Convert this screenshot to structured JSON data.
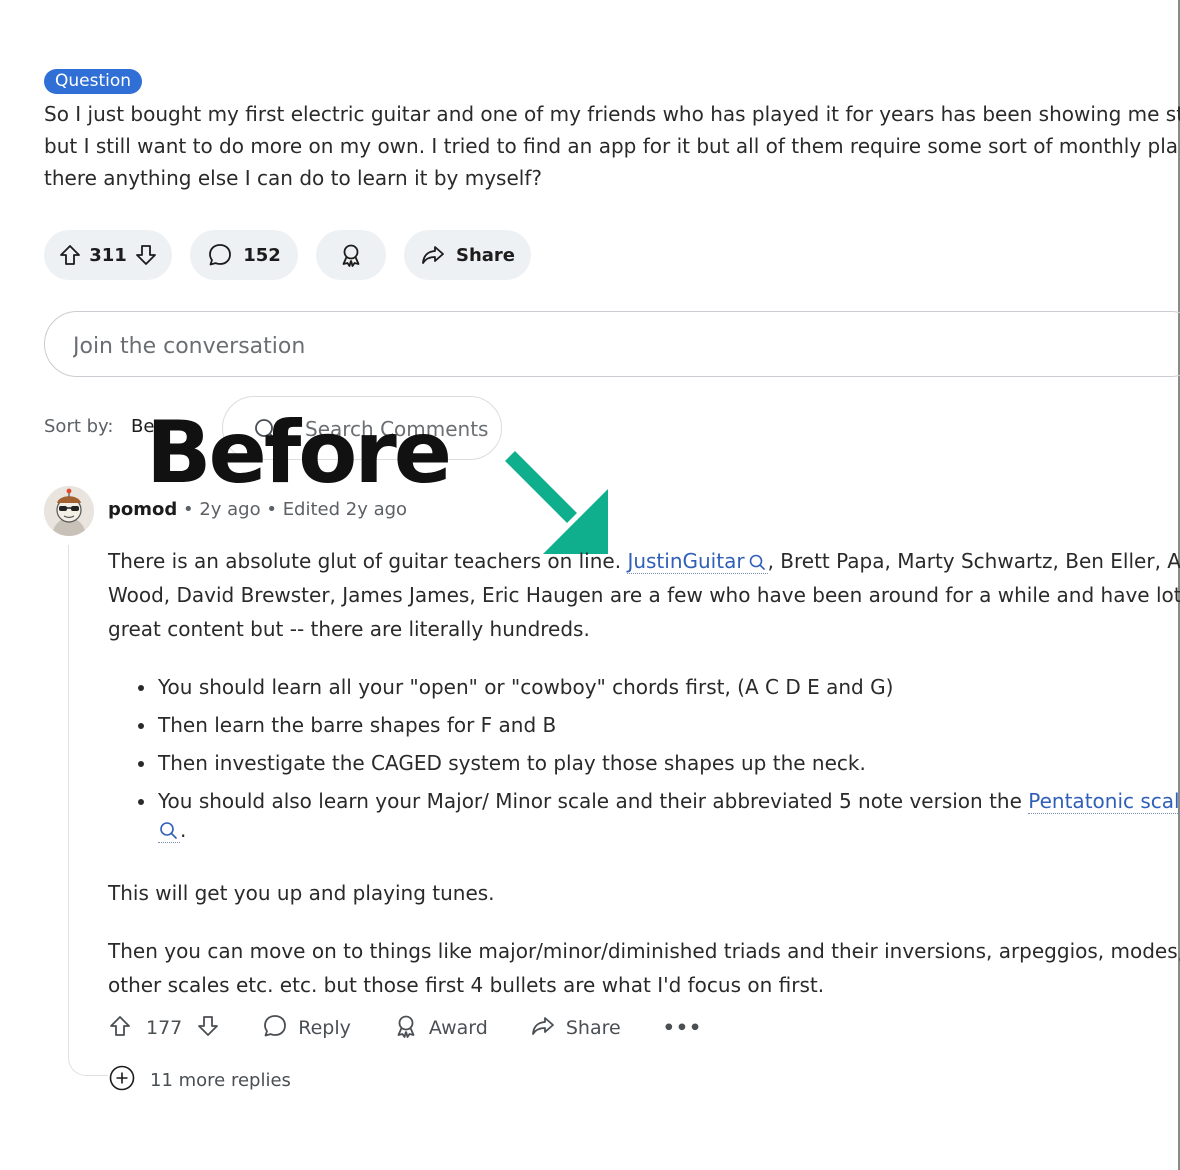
{
  "post": {
    "flair": "Question",
    "body_lines": [
      "So I just bought my first electric guitar and one of my friends who has played it for years has been showing me stuff",
      "but I still want to do more on my own. I tried to find an app for it but all of them require some sort of monthly plan.",
      "there anything else I can do to learn it by myself?"
    ],
    "upvotes": "311",
    "comments": "152",
    "share_label": "Share"
  },
  "composer": {
    "placeholder": "Join the conversation"
  },
  "sort": {
    "label": "Sort by:",
    "value": "Be"
  },
  "search": {
    "placeholder": "Search Comments"
  },
  "overlay": {
    "text": "Before",
    "arrow_color": "#0fae8c"
  },
  "comment": {
    "author": "pomod",
    "sep1": " • ",
    "age": "2y ago",
    "sep2": " • ",
    "edited": "Edited 2y ago",
    "intro": {
      "l1_before": "There is an absolute glut of guitar teachers on line. ",
      "l1_link": "JustinGuitar",
      "l1_after": ", Brett Papa, Marty Schwartz, Ben Eller, Andy",
      "l2": "Wood, David Brewster, James James, Eric Haugen are a few who have been around for a while and have lots of",
      "l3": "great content but -- there are literally hundreds."
    },
    "bullets": [
      "You should learn all your \"open\" or \"cowboy\" chords first, (A C D E and G)",
      "Then learn the barre shapes for F and B",
      "Then investigate the CAGED system to play those shapes up the neck."
    ],
    "bullet4_before": "You should also learn your Major/ Minor scale and their abbreviated 5 note version the ",
    "bullet4_link": "Pentatonic scale",
    "bullet4_end": ".",
    "para2": "This will get you up and playing tunes.",
    "para3_l1": "Then you can move on to things like major/minor/diminished triads and their inversions, arpeggios, modes,",
    "para3_l2": "other scales etc. etc. but those first 4 bullets are what I'd focus on first.",
    "votes": "177",
    "reply_label": "Reply",
    "award_label": "Award",
    "share_label": "Share",
    "more_label": "•••",
    "more_replies": "11 more replies"
  },
  "colors": {
    "flair": "#2f6fd6",
    "link": "#2f5fb8",
    "pill_bg": "#eef1f4"
  },
  "icons": [
    "upvote-icon",
    "downvote-icon",
    "comment-icon",
    "award-icon",
    "share-icon",
    "search-icon",
    "expand-icon",
    "more-icon"
  ]
}
